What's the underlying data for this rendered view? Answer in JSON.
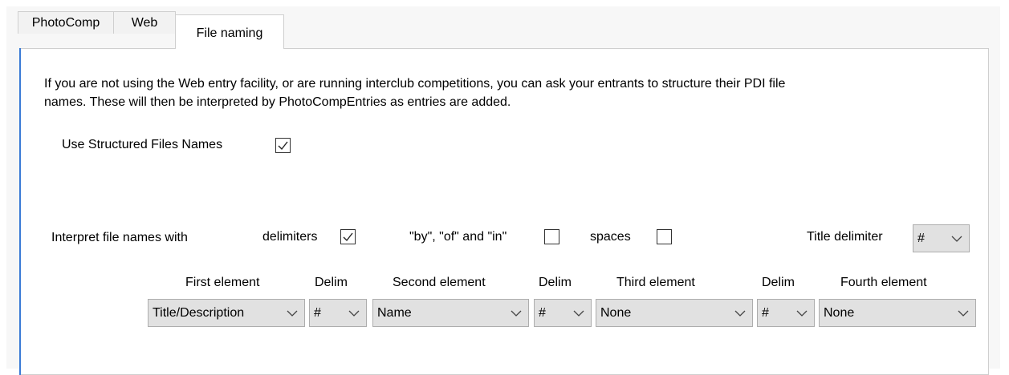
{
  "tabs": [
    {
      "label": "PhotoComp"
    },
    {
      "label": "Web"
    },
    {
      "label": "File naming"
    }
  ],
  "intro_line1": "If you are not using the Web entry facility, or are running interclub competitions, you can ask your entrants to structure their PDI file",
  "intro_line2": "names. These will then be interpreted by PhotoCompEntries as entries are added.",
  "use_structured": {
    "label": "Use Structured  Files Names",
    "checked": true
  },
  "interpret": {
    "label": "Interpret file names with",
    "delimiters": {
      "label": "delimiters",
      "checked": true
    },
    "byofin": {
      "label": "\"by\", \"of\" and \"in\"",
      "checked": false
    },
    "spaces": {
      "label": "spaces",
      "checked": false
    },
    "title_delim": {
      "label": "Title delimiter",
      "value": "#"
    }
  },
  "elements": {
    "headers": {
      "first": "First element",
      "delim1": "Delim",
      "second": "Second element",
      "delim2": "Delim",
      "third": "Third element",
      "delim3": "Delim",
      "fourth": "Fourth element"
    },
    "values": {
      "first": "Title/Description",
      "delim1": "#",
      "second": "Name",
      "delim2": "#",
      "third": "None",
      "delim3": "#",
      "fourth": "None"
    }
  },
  "icons": {
    "check": "checkmark-icon",
    "dropdown": "chevron-down-icon"
  }
}
